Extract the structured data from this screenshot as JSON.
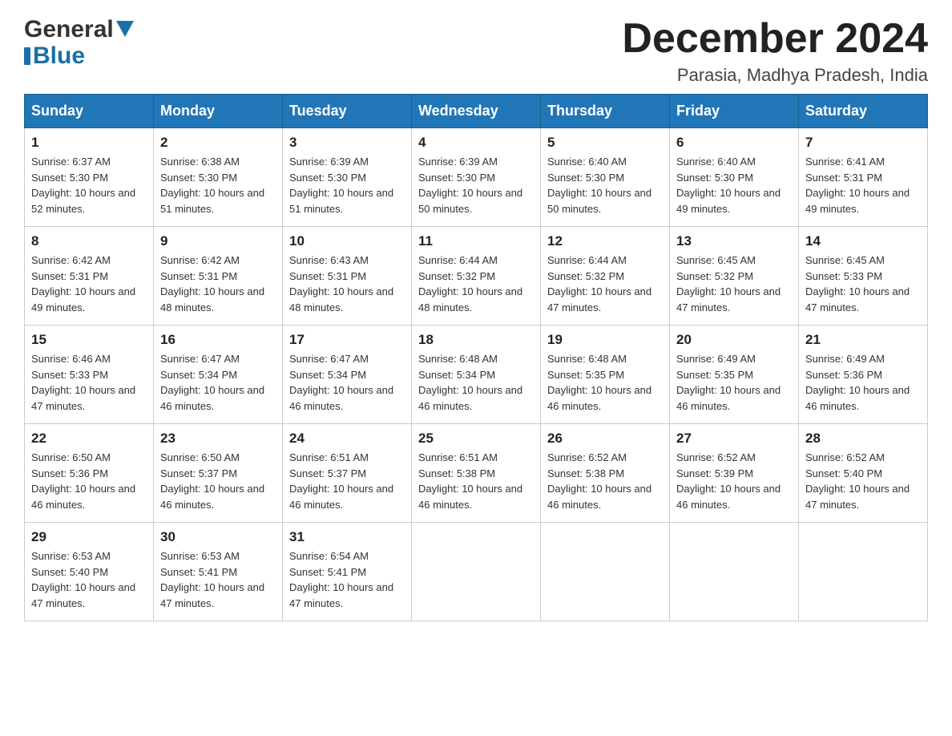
{
  "header": {
    "month_year": "December 2024",
    "location": "Parasia, Madhya Pradesh, India",
    "logo_general": "General",
    "logo_blue": "Blue"
  },
  "weekdays": [
    "Sunday",
    "Monday",
    "Tuesday",
    "Wednesday",
    "Thursday",
    "Friday",
    "Saturday"
  ],
  "weeks": [
    [
      {
        "day": "1",
        "sunrise": "6:37 AM",
        "sunset": "5:30 PM",
        "daylight": "10 hours and 52 minutes."
      },
      {
        "day": "2",
        "sunrise": "6:38 AM",
        "sunset": "5:30 PM",
        "daylight": "10 hours and 51 minutes."
      },
      {
        "day": "3",
        "sunrise": "6:39 AM",
        "sunset": "5:30 PM",
        "daylight": "10 hours and 51 minutes."
      },
      {
        "day": "4",
        "sunrise": "6:39 AM",
        "sunset": "5:30 PM",
        "daylight": "10 hours and 50 minutes."
      },
      {
        "day": "5",
        "sunrise": "6:40 AM",
        "sunset": "5:30 PM",
        "daylight": "10 hours and 50 minutes."
      },
      {
        "day": "6",
        "sunrise": "6:40 AM",
        "sunset": "5:30 PM",
        "daylight": "10 hours and 49 minutes."
      },
      {
        "day": "7",
        "sunrise": "6:41 AM",
        "sunset": "5:31 PM",
        "daylight": "10 hours and 49 minutes."
      }
    ],
    [
      {
        "day": "8",
        "sunrise": "6:42 AM",
        "sunset": "5:31 PM",
        "daylight": "10 hours and 49 minutes."
      },
      {
        "day": "9",
        "sunrise": "6:42 AM",
        "sunset": "5:31 PM",
        "daylight": "10 hours and 48 minutes."
      },
      {
        "day": "10",
        "sunrise": "6:43 AM",
        "sunset": "5:31 PM",
        "daylight": "10 hours and 48 minutes."
      },
      {
        "day": "11",
        "sunrise": "6:44 AM",
        "sunset": "5:32 PM",
        "daylight": "10 hours and 48 minutes."
      },
      {
        "day": "12",
        "sunrise": "6:44 AM",
        "sunset": "5:32 PM",
        "daylight": "10 hours and 47 minutes."
      },
      {
        "day": "13",
        "sunrise": "6:45 AM",
        "sunset": "5:32 PM",
        "daylight": "10 hours and 47 minutes."
      },
      {
        "day": "14",
        "sunrise": "6:45 AM",
        "sunset": "5:33 PM",
        "daylight": "10 hours and 47 minutes."
      }
    ],
    [
      {
        "day": "15",
        "sunrise": "6:46 AM",
        "sunset": "5:33 PM",
        "daylight": "10 hours and 47 minutes."
      },
      {
        "day": "16",
        "sunrise": "6:47 AM",
        "sunset": "5:34 PM",
        "daylight": "10 hours and 46 minutes."
      },
      {
        "day": "17",
        "sunrise": "6:47 AM",
        "sunset": "5:34 PM",
        "daylight": "10 hours and 46 minutes."
      },
      {
        "day": "18",
        "sunrise": "6:48 AM",
        "sunset": "5:34 PM",
        "daylight": "10 hours and 46 minutes."
      },
      {
        "day": "19",
        "sunrise": "6:48 AM",
        "sunset": "5:35 PM",
        "daylight": "10 hours and 46 minutes."
      },
      {
        "day": "20",
        "sunrise": "6:49 AM",
        "sunset": "5:35 PM",
        "daylight": "10 hours and 46 minutes."
      },
      {
        "day": "21",
        "sunrise": "6:49 AM",
        "sunset": "5:36 PM",
        "daylight": "10 hours and 46 minutes."
      }
    ],
    [
      {
        "day": "22",
        "sunrise": "6:50 AM",
        "sunset": "5:36 PM",
        "daylight": "10 hours and 46 minutes."
      },
      {
        "day": "23",
        "sunrise": "6:50 AM",
        "sunset": "5:37 PM",
        "daylight": "10 hours and 46 minutes."
      },
      {
        "day": "24",
        "sunrise": "6:51 AM",
        "sunset": "5:37 PM",
        "daylight": "10 hours and 46 minutes."
      },
      {
        "day": "25",
        "sunrise": "6:51 AM",
        "sunset": "5:38 PM",
        "daylight": "10 hours and 46 minutes."
      },
      {
        "day": "26",
        "sunrise": "6:52 AM",
        "sunset": "5:38 PM",
        "daylight": "10 hours and 46 minutes."
      },
      {
        "day": "27",
        "sunrise": "6:52 AM",
        "sunset": "5:39 PM",
        "daylight": "10 hours and 46 minutes."
      },
      {
        "day": "28",
        "sunrise": "6:52 AM",
        "sunset": "5:40 PM",
        "daylight": "10 hours and 47 minutes."
      }
    ],
    [
      {
        "day": "29",
        "sunrise": "6:53 AM",
        "sunset": "5:40 PM",
        "daylight": "10 hours and 47 minutes."
      },
      {
        "day": "30",
        "sunrise": "6:53 AM",
        "sunset": "5:41 PM",
        "daylight": "10 hours and 47 minutes."
      },
      {
        "day": "31",
        "sunrise": "6:54 AM",
        "sunset": "5:41 PM",
        "daylight": "10 hours and 47 minutes."
      },
      null,
      null,
      null,
      null
    ]
  ],
  "labels": {
    "sunrise_prefix": "Sunrise: ",
    "sunset_prefix": "Sunset: ",
    "daylight_prefix": "Daylight: "
  }
}
